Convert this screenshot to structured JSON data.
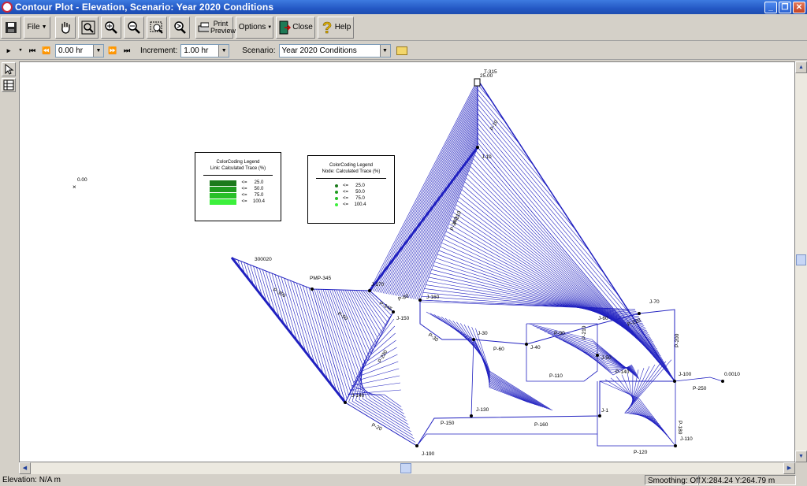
{
  "window": {
    "title": "Contour Plot - Elevation, Scenario: Year 2020 Conditions"
  },
  "toolbar": {
    "file_label": "File",
    "print_preview_label": "Print Preview",
    "options_label": "Options",
    "close_label": "Close",
    "help_label": "Help"
  },
  "timebar": {
    "time_value": "0.00 hr",
    "increment_label": "Increment:",
    "increment_value": "1.00 hr",
    "scenario_label": "Scenario:",
    "scenario_value": "Year 2020 Conditions"
  },
  "legend_link": {
    "title1": "ColorCoding Legend",
    "title2": "Link: Calculated Trace (%)",
    "rows": [
      {
        "op": "<=",
        "value": "25.0",
        "color": "#1c7a1c"
      },
      {
        "op": "<=",
        "value": "50.0",
        "color": "#1f9a1f"
      },
      {
        "op": "<=",
        "value": "75.0",
        "color": "#28c028"
      },
      {
        "op": "<=",
        "value": "100.4",
        "color": "#3cf03c"
      }
    ]
  },
  "legend_node": {
    "title1": "ColorCoding Legend",
    "title2": "Node: Calculated Trace (%)",
    "rows": [
      {
        "op": "<=",
        "value": "25.0",
        "color": "#1c7a1c"
      },
      {
        "op": "<=",
        "value": "50.0",
        "color": "#1f9a1f"
      },
      {
        "op": "<=",
        "value": "75.0",
        "color": "#28c028"
      },
      {
        "op": "<=",
        "value": "100.4",
        "color": "#3cf03c"
      }
    ]
  },
  "plot": {
    "origin_label": "0.00",
    "contour_color": "#2020c0",
    "labels": {
      "t315": "T-315",
      "t315b": "25.00",
      "r": "300020",
      "pmp": "PMP-345",
      "j10": "J-10",
      "j170": "J-170",
      "j150": "J-150",
      "j160": "J-160",
      "j70": "J-70",
      "j60": "J-60",
      "j30": "J-30",
      "j40": "J-40",
      "j50": "J-50",
      "j100": "J-100",
      "j1": "J-1",
      "j130": "J-130",
      "j140": "J-140",
      "j190": "J-190",
      "j110": "J-110",
      "nr": "0.0010",
      "p10": "P-10",
      "p20": "P-20",
      "p30": "P-30",
      "p50": "P-50",
      "p60": "P-60",
      "p80": "P-80",
      "p90": "P-90",
      "p110": "P-110",
      "p120": "P-120",
      "p140": "P-140",
      "p150": "P-150",
      "p160": "P-160",
      "p180": "P-180",
      "p200": "P-200",
      "p210": "P-210",
      "p220": "P-220",
      "p230": "P-230",
      "p240": "P-240",
      "p250": "P-250",
      "p310": "P-310",
      "p345": "P-345",
      "p350": "P-350"
    }
  },
  "status": {
    "elevation": "Elevation: N/A m",
    "smoothing": "Smoothing: Off",
    "coords": "X:284.24  Y:264.79 m"
  }
}
